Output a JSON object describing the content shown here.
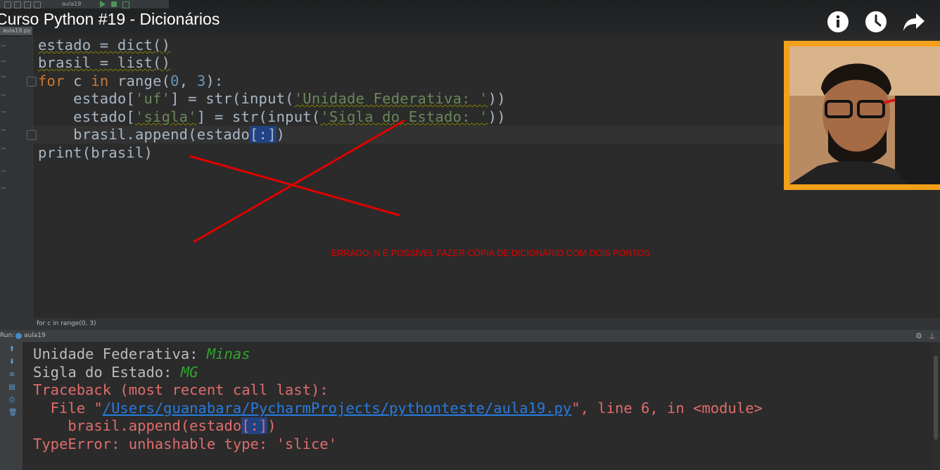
{
  "video": {
    "title": "Curso Python #19 - Dicionários",
    "controls": [
      {
        "name": "info-icon",
        "glyph": "i"
      },
      {
        "name": "watch-later-icon",
        "glyph": "clock"
      },
      {
        "name": "share-icon",
        "glyph": "arrow"
      }
    ]
  },
  "ide": {
    "toolbar_run_config": "aula19",
    "file_tab": "aula19.py",
    "breadcrumb": "for c in range(0, 3)",
    "run_tab": "aula19",
    "run_label": "Run:"
  },
  "code_lines": [
    "estado = dict()",
    "brasil = list()",
    "for c in range(0, 3):",
    "    estado['uf'] = str(input('Unidade Federativa: '))",
    "    estado['sigla'] = str(input('Sigla do Estado: '))",
    "    brasil.append(estado[:])",
    "print(brasil)"
  ],
  "annotation": {
    "text": "ERRADO, N É POSSÍVEL FAZER CÓPIA DE DICIONÁRIO COM DOIS PONTOS",
    "color": "#e00000"
  },
  "console": {
    "line1_label": "Unidade Federativa: ",
    "line1_input": "Minas",
    "line2_label": "Sigla do Estado: ",
    "line2_input": "MG",
    "traceback": "Traceback (most recent call last):",
    "file_prefix": "  File \"",
    "file_path": "/Users/guanabara/PycharmProjects/pythonteste/aula19.py",
    "file_suffix": "\", line 6, in <module>",
    "code_line_prefix": "    brasil.append(estado",
    "code_line_sel": "[:]",
    "code_line_suffix": ")",
    "error": "TypeError: unhashable type: 'slice'"
  },
  "colors": {
    "keyword": "#cc7832",
    "number": "#6897bb",
    "string": "#6a8759",
    "error": "#e06c6c",
    "link": "#287bde",
    "cam_frame": "#f3a01b"
  }
}
